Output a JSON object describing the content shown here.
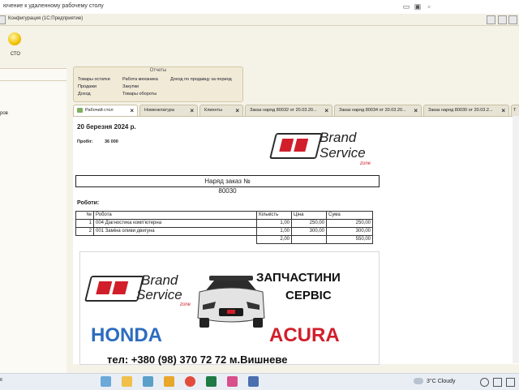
{
  "window": {
    "title": "ючение к удаленному рабочему столу",
    "watermark": "auto"
  },
  "menubar": {
    "app_label": "Конфигурация  (1С:Предприятие)"
  },
  "section": {
    "sto_label": "СТО"
  },
  "left_panel": {
    "text": "ров"
  },
  "reports": {
    "header": "Отчеты",
    "col1": [
      "Товары остатки",
      "Продажи",
      "Доход"
    ],
    "col2": [
      "Работа механика",
      "Закупки",
      "Товары обороты"
    ],
    "col3": [
      "Доход по продавцу за период"
    ]
  },
  "tabs": [
    {
      "label": "Рабочий стол"
    },
    {
      "label": "Номенклатура"
    },
    {
      "label": "Клиенты"
    },
    {
      "label": "Заказ наряд 80032 от 20.03.20..."
    },
    {
      "label": "Заказ наряд 80034 от 20.03.20..."
    },
    {
      "label": "Заказ наряд 80030 от 20.03.2..."
    },
    {
      "label": "Т"
    }
  ],
  "document": {
    "date": "20 березня 2024 р.",
    "mileage_label": "Пробіг:",
    "mileage_value": "36 000",
    "brand": {
      "line1": "Brand",
      "line2": "Service",
      "zone": "zone"
    },
    "order_title": "Наряд заказ №",
    "order_number": "80030",
    "works_label": "Роботи:",
    "table": {
      "headers": [
        "№",
        "Робота",
        "Кількість",
        "Ціна",
        "Сума"
      ],
      "rows": [
        [
          "1",
          "004 Діагностика комп'ютерна",
          "1,00",
          "250,00",
          "250,00"
        ],
        [
          "2",
          "001 Заміна оливи двигуна",
          "1,00",
          "300,00",
          "300,00"
        ]
      ],
      "total_qty": "2,00",
      "total_sum": "550,00"
    },
    "banner": {
      "line1": "ЗАПЧАСТИНИ",
      "line2": "СЕРВІС",
      "honda": "HONDA",
      "acura": "ACURA",
      "phone": "тел: +380 (98) 370 72 72 м.Вишневе"
    }
  },
  "taskbar": {
    "search": "к",
    "weather": "3°C  Cloudy"
  },
  "colors": {
    "brand_red": "#d11e2a",
    "honda_blue": "#2d6cc0",
    "panel_bg": "#f5f2e7"
  }
}
